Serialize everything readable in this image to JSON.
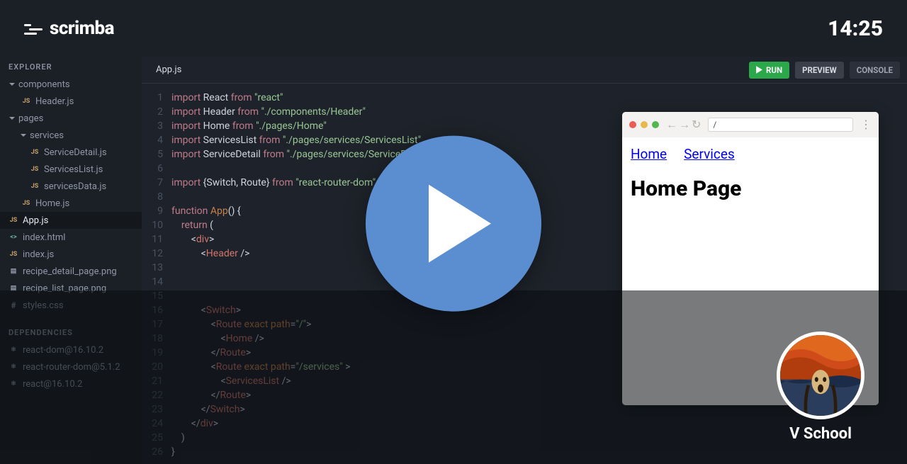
{
  "header": {
    "brand": "scrimba",
    "timestamp": "14:25"
  },
  "sidebar": {
    "explorer_label": "EXPLORER",
    "deps_label": "DEPENDENCIES",
    "tree": {
      "components": {
        "label": "components",
        "children": [
          {
            "label": "Header.js",
            "t": "js"
          }
        ]
      },
      "pages": {
        "label": "pages",
        "children": {
          "services": {
            "label": "services",
            "children": [
              {
                "label": "ServiceDetail.js",
                "t": "js"
              },
              {
                "label": "ServicesList.js",
                "t": "js"
              },
              {
                "label": "servicesData.js",
                "t": "js"
              }
            ]
          },
          "home": {
            "label": "Home.js",
            "t": "js"
          }
        }
      },
      "root": [
        {
          "label": "App.js",
          "t": "js",
          "selected": true
        },
        {
          "label": "index.html",
          "t": "html"
        },
        {
          "label": "index.js",
          "t": "js"
        },
        {
          "label": "recipe_detail_page.png",
          "t": "img"
        },
        {
          "label": "recipe_list_page.png",
          "t": "img"
        },
        {
          "label": "styles.css",
          "t": "hash"
        }
      ]
    },
    "deps": [
      {
        "label": "react-dom@16.10.2"
      },
      {
        "label": "react-router-dom@5.1.2"
      },
      {
        "label": "react@16.10.2"
      }
    ]
  },
  "tabbar": {
    "filetab": "App.js",
    "run": "RUN",
    "preview": "PREVIEW",
    "console": "CONSOLE"
  },
  "code_lines": [
    {
      "n": 1,
      "html": "<span class='kw'>import</span> React <span class='kw'>from</span> <span class='str'>\"react\"</span>"
    },
    {
      "n": 2,
      "html": "<span class='kw'>import</span> Header <span class='kw'>from</span> <span class='str'>\"./components/Header\"</span>"
    },
    {
      "n": 3,
      "html": "<span class='kw'>import</span> Home <span class='kw'>from</span> <span class='str'>\"./pages/Home\"</span>"
    },
    {
      "n": 4,
      "html": "<span class='kw'>import</span> ServicesList <span class='kw'>from</span> <span class='str'>\"./pages/services/ServicesList\"</span>"
    },
    {
      "n": 5,
      "html": "<span class='kw'>import</span> ServiceDetail <span class='kw'>from</span> <span class='str'>\"./pages/services/ServiceDetail\"</span>"
    },
    {
      "n": 6,
      "html": ""
    },
    {
      "n": 7,
      "html": "<span class='kw'>import</span> {Switch, Route} <span class='kw'>from</span> <span class='str'>\"react-router-dom\"</span>"
    },
    {
      "n": 8,
      "html": ""
    },
    {
      "n": 9,
      "html": "<span class='kw'>function</span> <span class='attr'>App</span>() {"
    },
    {
      "n": 10,
      "html": "    <span class='kw'>return</span> ("
    },
    {
      "n": 11,
      "html": "        <span class='punc'>&lt;</span><span class='tag'>div</span><span class='punc'>&gt;</span>"
    },
    {
      "n": 12,
      "html": "            <span class='punc'>&lt;</span><span class='tag'>Header</span> <span class='punc'>/&gt;</span>"
    },
    {
      "n": 13,
      "html": ""
    },
    {
      "n": 14,
      "html": "            "
    },
    {
      "n": 15,
      "html": ""
    },
    {
      "n": 16,
      "html": "            <span class='punc'>&lt;</span><span class='tag'>Switch</span><span class='punc'>&gt;</span>"
    },
    {
      "n": 17,
      "html": "                <span class='punc'>&lt;</span><span class='tag'>Route</span> <span class='attr'>exact path</span>=<span class='str'>\"/\"</span><span class='punc'>&gt;</span>"
    },
    {
      "n": 18,
      "html": "                    <span class='punc'>&lt;</span><span class='tag'>Home</span> <span class='punc'>/&gt;</span>"
    },
    {
      "n": 19,
      "html": "                <span class='punc'>&lt;/</span><span class='tag'>Route</span><span class='punc'>&gt;</span>"
    },
    {
      "n": 20,
      "html": "                <span class='punc'>&lt;</span><span class='tag'>Route</span> <span class='attr'>exact path</span>=<span class='str'>\"/services\"</span> <span class='punc'>&gt;</span>"
    },
    {
      "n": 21,
      "html": "                    <span class='punc'>&lt;</span><span class='tag'>ServicesList</span> <span class='punc'>/&gt;</span>"
    },
    {
      "n": 22,
      "html": "                <span class='punc'>&lt;/</span><span class='tag'>Route</span><span class='punc'>&gt;</span>"
    },
    {
      "n": 23,
      "html": "            <span class='punc'>&lt;/</span><span class='tag'>Switch</span><span class='punc'>&gt;</span>"
    },
    {
      "n": 24,
      "html": "        <span class='punc'>&lt;/</span><span class='tag'>div</span><span class='punc'>&gt;</span>"
    },
    {
      "n": 25,
      "html": "    )"
    },
    {
      "n": 26,
      "html": "}"
    }
  ],
  "browser_preview": {
    "path": "/",
    "nav": [
      {
        "label": "Home"
      },
      {
        "label": "Services"
      }
    ],
    "heading": "Home Page"
  },
  "avatar": {
    "name": "V School"
  }
}
